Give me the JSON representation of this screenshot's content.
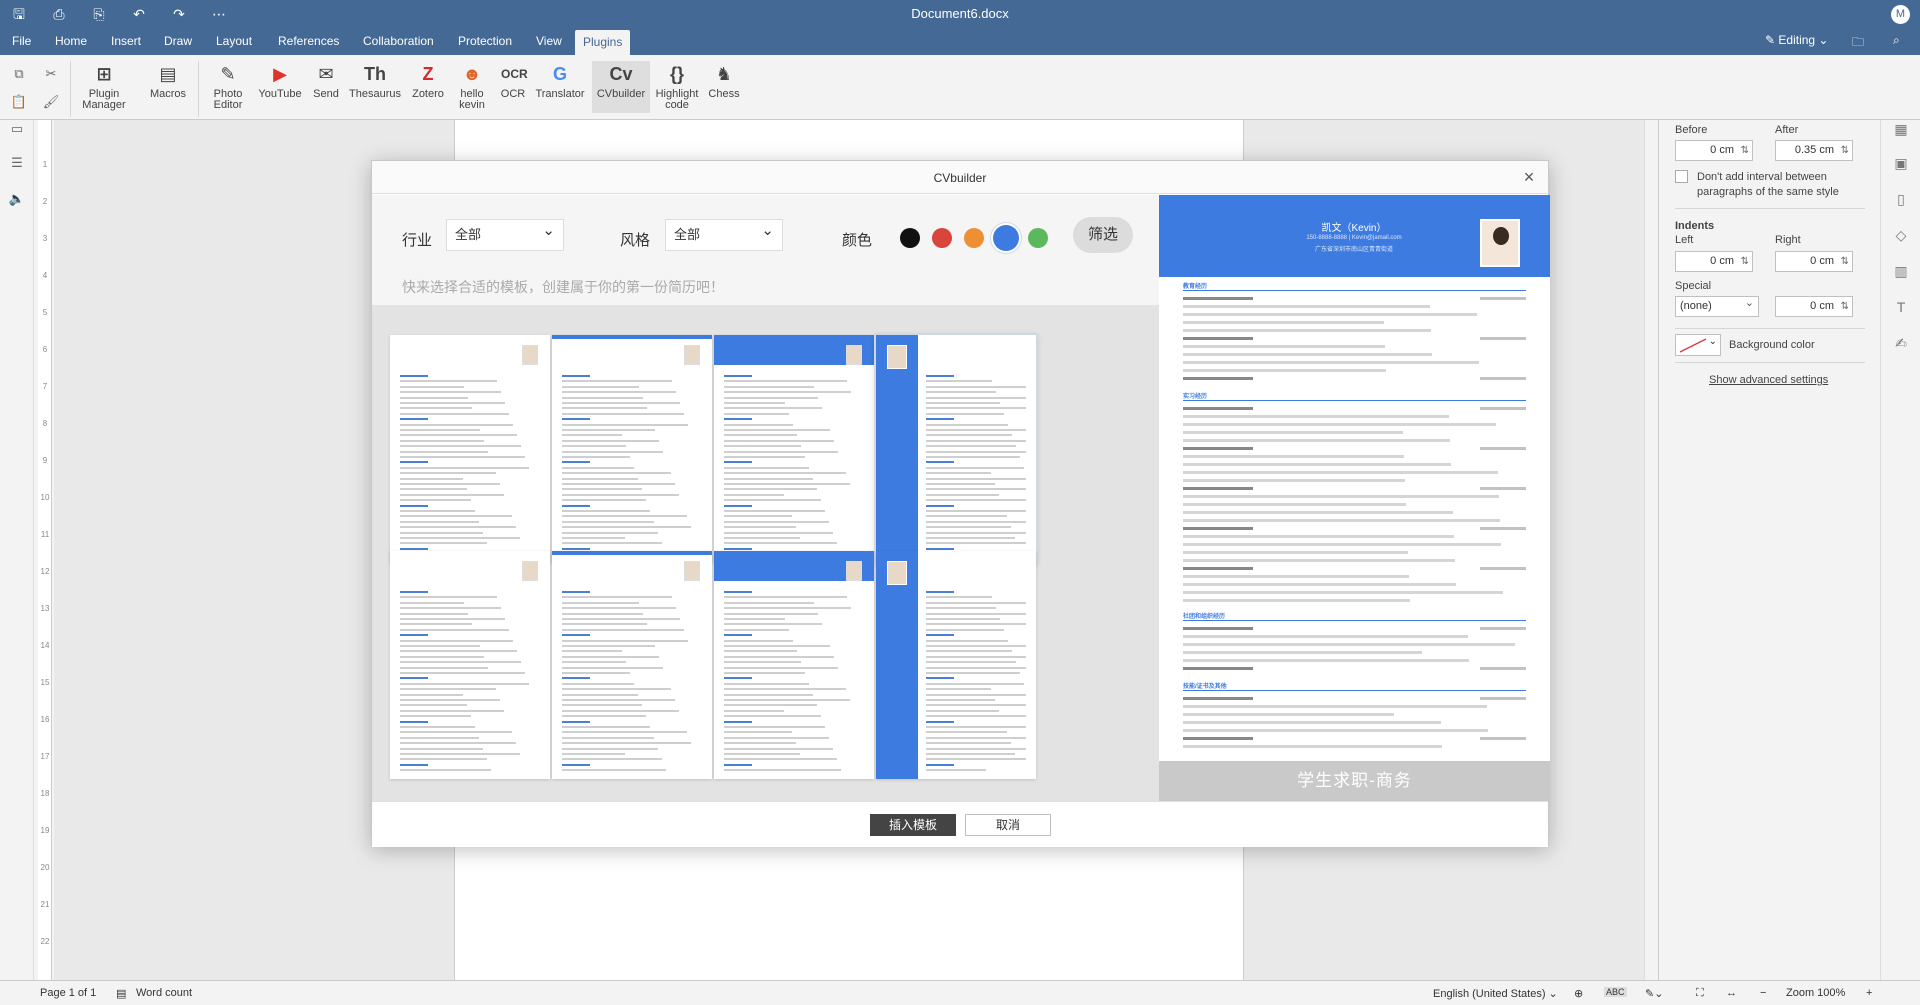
{
  "app": {
    "title": "Document6.docx",
    "user_initial": "M",
    "editing_label": "Editing"
  },
  "menu": {
    "tabs": [
      "File",
      "Home",
      "Insert",
      "Draw",
      "Layout",
      "References",
      "Collaboration",
      "Protection",
      "View",
      "Plugins"
    ],
    "active": "Plugins"
  },
  "toolbar": {
    "plugin_manager": "Plugin\nManager",
    "macros": "Macros",
    "photo_editor": "Photo\nEditor",
    "youtube": "YouTube",
    "send": "Send",
    "thesaurus": "Thesaurus",
    "zotero": "Zotero",
    "hello_kevin": "hello\nkevin",
    "ocr": "OCR",
    "translator": "Translator",
    "cvbuilder": "CVbuilder",
    "highlight_code": "Highlight\ncode",
    "chess": "Chess"
  },
  "ruler_numbers": [
    "1",
    "2",
    "3",
    "4",
    "5",
    "6",
    "7",
    "8",
    "9",
    "10",
    "11",
    "12",
    "13",
    "14",
    "15",
    "16",
    "17",
    "18",
    "19",
    "20",
    "21",
    "22"
  ],
  "right_panel": {
    "before_label": "Before",
    "after_label": "After",
    "before_value": "0 cm",
    "after_value": "0.35 cm",
    "no_interval_text": "Don't add interval between paragraphs of the same style",
    "indents_label": "Indents",
    "left_label": "Left",
    "right_label": "Right",
    "left_value": "0 cm",
    "right_value": "0 cm",
    "special_label": "Special",
    "special_value": "(none)",
    "special_amount": "0 cm",
    "background_color_label": "Background color",
    "advanced_link": "Show advanced settings"
  },
  "status": {
    "page": "Page 1 of 1",
    "word_count": "Word count",
    "language": "English (United States)",
    "zoom": "Zoom 100%"
  },
  "dialog": {
    "title": "CVbuilder",
    "industry_label": "行业",
    "industry_value": "全部",
    "style_label": "风格",
    "style_value": "全部",
    "color_label": "颜色",
    "colors": [
      "#111111",
      "#d9453b",
      "#ef8f33",
      "#3d7be0",
      "#5cb85c"
    ],
    "selected_color": "#3d7be0",
    "filter_button": "筛选",
    "hint": "快来选择合适的模板，创建属于你的第一份简历吧！",
    "preview_name": "凯文（Kevin）",
    "preview_contact": "150-8888-8888 | Kevin@jamail.com",
    "preview_location": "广东省深圳市南山区青青街道",
    "preview_sections": [
      "教育经历",
      "实习经历",
      "社团和组织经历",
      "技能/证书及其他"
    ],
    "preview_footer": "学生求职-商务",
    "insert_button": "插入模板",
    "cancel_button": "取消"
  }
}
